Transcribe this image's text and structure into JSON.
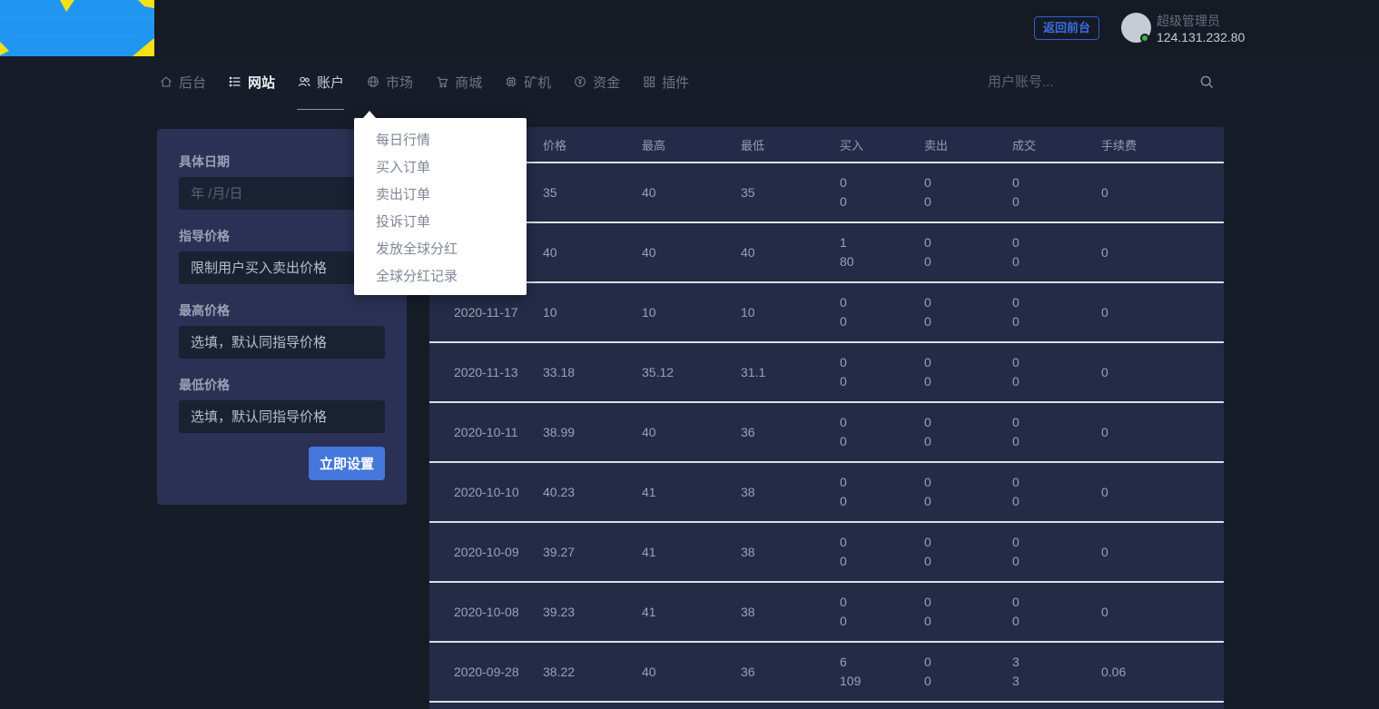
{
  "topbar": {
    "back_button": "返回前台",
    "user_name": "超级管理员",
    "user_ip": "124.131.232.80"
  },
  "nav": {
    "items": [
      {
        "label": "后台",
        "icon": "home-icon",
        "state": "default"
      },
      {
        "label": "网站",
        "icon": "list-icon",
        "state": "bright"
      },
      {
        "label": "账户",
        "icon": "users-icon",
        "state": "underlined"
      },
      {
        "label": "市场",
        "icon": "globe-icon",
        "state": "default"
      },
      {
        "label": "商城",
        "icon": "cart-icon",
        "state": "default"
      },
      {
        "label": "矿机",
        "icon": "cpu-icon",
        "state": "default"
      },
      {
        "label": "资金",
        "icon": "money-icon",
        "state": "default"
      },
      {
        "label": "插件",
        "icon": "plugin-icon",
        "state": "default"
      }
    ],
    "search_placeholder": "用户账号..."
  },
  "market_menu": {
    "items": [
      "每日行情",
      "买入订单",
      "卖出订单",
      "投诉订单",
      "发放全球分红",
      "全球分红记录"
    ]
  },
  "filter_panel": {
    "fields": [
      {
        "name": "date",
        "label": "具体日期",
        "placeholder": "年 /月/日",
        "dim": true
      },
      {
        "name": "guide-price",
        "label": "指导价格",
        "placeholder": "限制用户买入卖出价格",
        "dim": false
      },
      {
        "name": "max-price",
        "label": "最高价格",
        "placeholder": "选填，默认同指导价格",
        "dim": false
      },
      {
        "name": "min-price",
        "label": "最低价格",
        "placeholder": "选填，默认同指导价格",
        "dim": false
      }
    ],
    "submit_label": "立即设置"
  },
  "table": {
    "columns": [
      {
        "key": "date",
        "label": ""
      },
      {
        "key": "price",
        "label": "价格"
      },
      {
        "key": "high",
        "label": "最高"
      },
      {
        "key": "low",
        "label": "最低"
      },
      {
        "key": "buy",
        "label": "买入"
      },
      {
        "key": "sell",
        "label": "卖出"
      },
      {
        "key": "deal",
        "label": "成交"
      },
      {
        "key": "fee",
        "label": "手续费"
      }
    ],
    "rows": [
      {
        "date": "",
        "price": "35",
        "high": "40",
        "low": "35",
        "buy": [
          "0",
          "0"
        ],
        "sell": [
          "0",
          "0"
        ],
        "deal": [
          "0",
          "0"
        ],
        "fee": "0"
      },
      {
        "date": "",
        "price": "40",
        "high": "40",
        "low": "40",
        "buy": [
          "1",
          "80"
        ],
        "sell": [
          "0",
          "0"
        ],
        "deal": [
          "0",
          "0"
        ],
        "fee": "0"
      },
      {
        "date": "2020-11-17",
        "price": "10",
        "high": "10",
        "low": "10",
        "buy": [
          "0",
          "0"
        ],
        "sell": [
          "0",
          "0"
        ],
        "deal": [
          "0",
          "0"
        ],
        "fee": "0"
      },
      {
        "date": "2020-11-13",
        "price": "33.18",
        "high": "35.12",
        "low": "31.1",
        "buy": [
          "0",
          "0"
        ],
        "sell": [
          "0",
          "0"
        ],
        "deal": [
          "0",
          "0"
        ],
        "fee": "0"
      },
      {
        "date": "2020-10-11",
        "price": "38.99",
        "high": "40",
        "low": "36",
        "buy": [
          "0",
          "0"
        ],
        "sell": [
          "0",
          "0"
        ],
        "deal": [
          "0",
          "0"
        ],
        "fee": "0"
      },
      {
        "date": "2020-10-10",
        "price": "40.23",
        "high": "41",
        "low": "38",
        "buy": [
          "0",
          "0"
        ],
        "sell": [
          "0",
          "0"
        ],
        "deal": [
          "0",
          "0"
        ],
        "fee": "0"
      },
      {
        "date": "2020-10-09",
        "price": "39.27",
        "high": "41",
        "low": "38",
        "buy": [
          "0",
          "0"
        ],
        "sell": [
          "0",
          "0"
        ],
        "deal": [
          "0",
          "0"
        ],
        "fee": "0"
      },
      {
        "date": "2020-10-08",
        "price": "39.23",
        "high": "41",
        "low": "38",
        "buy": [
          "0",
          "0"
        ],
        "sell": [
          "0",
          "0"
        ],
        "deal": [
          "0",
          "0"
        ],
        "fee": "0"
      },
      {
        "date": "2020-09-28",
        "price": "38.22",
        "high": "40",
        "low": "36",
        "buy": [
          "6",
          "109"
        ],
        "sell": [
          "0",
          "0"
        ],
        "deal": [
          "3",
          "3"
        ],
        "fee": "0.06"
      }
    ]
  },
  "colors": {
    "page_bg": "#171c29",
    "topbar_bg": "#151a24",
    "panel_bg": "#2a3154",
    "input_bg": "#1a2133",
    "row_bg": "#232b47",
    "row_border": "#dcdfe8",
    "accent_blue": "#4477d9",
    "back_button_blue": "#2e5fd0",
    "status_green": "#3db549",
    "logo_blue": "#2196f0",
    "logo_yellow": "#f5e115"
  }
}
